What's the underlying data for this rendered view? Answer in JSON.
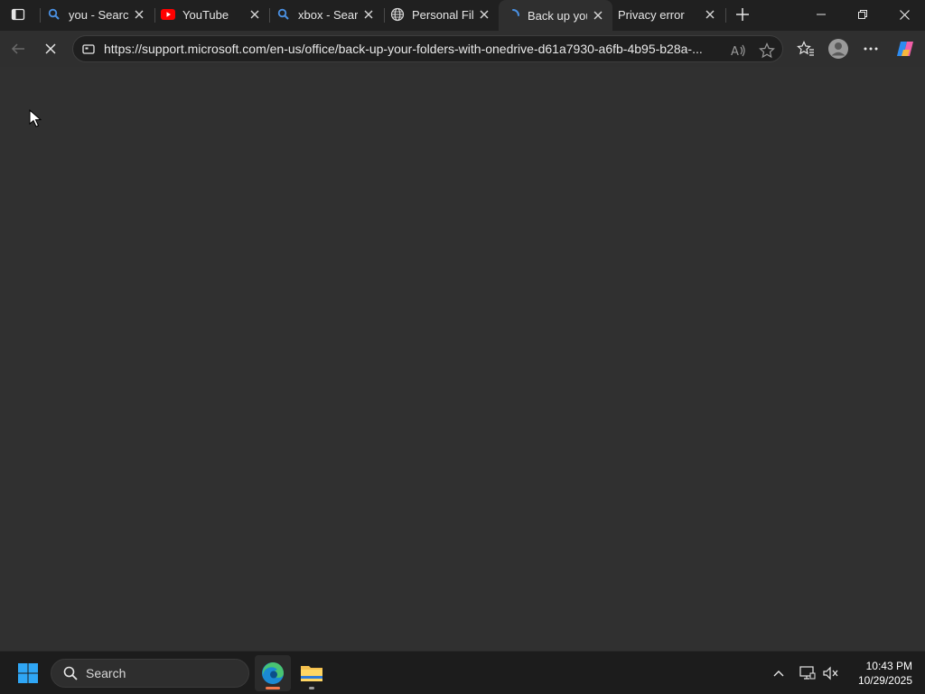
{
  "browser": {
    "tabs": [
      {
        "title": "you - Search",
        "icon": "search-icon",
        "active": false
      },
      {
        "title": "YouTube",
        "icon": "youtube-icon",
        "active": false
      },
      {
        "title": "xbox - Search",
        "icon": "search-icon",
        "active": false
      },
      {
        "title": "Personal Files",
        "icon": "globe-icon",
        "active": false
      },
      {
        "title": "Back up your",
        "icon": "loading-spinner-icon",
        "active": true
      },
      {
        "title": "Privacy error",
        "icon": "none",
        "active": false
      }
    ],
    "address_bar": {
      "url": "https://support.microsoft.com/en-us/office/back-up-your-folders-with-onedrive-d61a7930-a6fb-4b95-b28a-..."
    },
    "colors": {
      "accent": "#2f7bd8",
      "youtube_red": "#ff0000",
      "content_bg": "#303030",
      "chrome_bg": "#202020"
    }
  },
  "taskbar": {
    "search_placeholder": "Search",
    "clock": {
      "time": "10:43 PM",
      "date": "10/29/2025"
    },
    "apps": [
      "edge-icon",
      "file-explorer-icon"
    ]
  }
}
